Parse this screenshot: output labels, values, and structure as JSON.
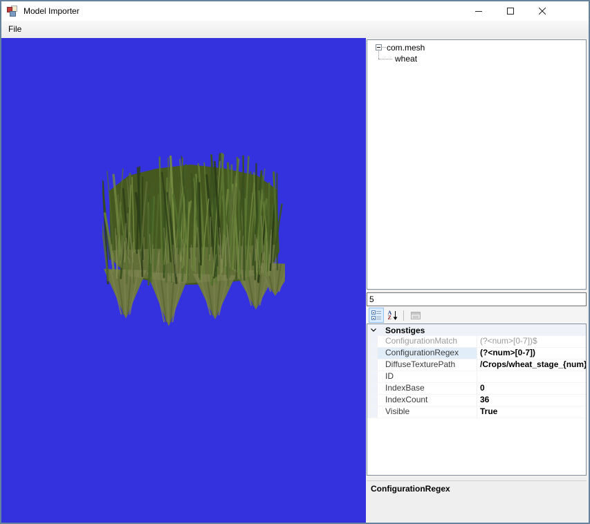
{
  "window": {
    "title": "Model Importer",
    "border_color": "#65829F"
  },
  "titlebar": {
    "icons": {
      "app": "winforms-app-icon",
      "minimize": "minimize-icon",
      "maximize": "maximize-icon",
      "close": "close-icon"
    }
  },
  "menubar": {
    "items": [
      {
        "label": "File"
      }
    ]
  },
  "viewport": {
    "background_color": "#3431DE",
    "model": "wheat-crop-model"
  },
  "scene_tree": {
    "nodes": [
      {
        "label": "com.mesh",
        "expanded": true,
        "children": [
          {
            "label": "wheat"
          }
        ]
      }
    ]
  },
  "config_input": {
    "value": "5"
  },
  "property_grid": {
    "toolbar": {
      "icons": {
        "categorized": "categorized-icon",
        "alphabetical": "alphabetical-sort-icon",
        "property_pages": "property-pages-icon"
      }
    },
    "categories": [
      {
        "label": "Sonstiges",
        "rows": [
          {
            "name": "ConfigurationMatch",
            "value": "(?<num>[0-7])$",
            "state": "readonly"
          },
          {
            "name": "ConfigurationRegex",
            "value": "(?<num>[0-7])",
            "state": "selected"
          },
          {
            "name": "DiffuseTexturePath",
            "value": "/Crops/wheat_stage_{num}",
            "state": "modified"
          },
          {
            "name": "ID",
            "value": "",
            "state": "normal"
          },
          {
            "name": "IndexBase",
            "value": "0",
            "state": "modified"
          },
          {
            "name": "IndexCount",
            "value": "36",
            "state": "modified"
          },
          {
            "name": "Visible",
            "value": "True",
            "state": "modified"
          }
        ]
      }
    ],
    "help_panel": {
      "title": "ConfigurationRegex",
      "description": ""
    }
  },
  "colors": {
    "viewport_blue": "#3431DE",
    "selection_bg": "#E1EEFA",
    "category_bg": "#EFF3F9",
    "readonly_text": "#9B9B9B",
    "grass_greens": [
      "#2C3E18",
      "#38501F",
      "#445E25",
      "#506C2B",
      "#5C7732",
      "#688139",
      "#748B41"
    ],
    "grass_base_khaki": "#7F854F"
  }
}
